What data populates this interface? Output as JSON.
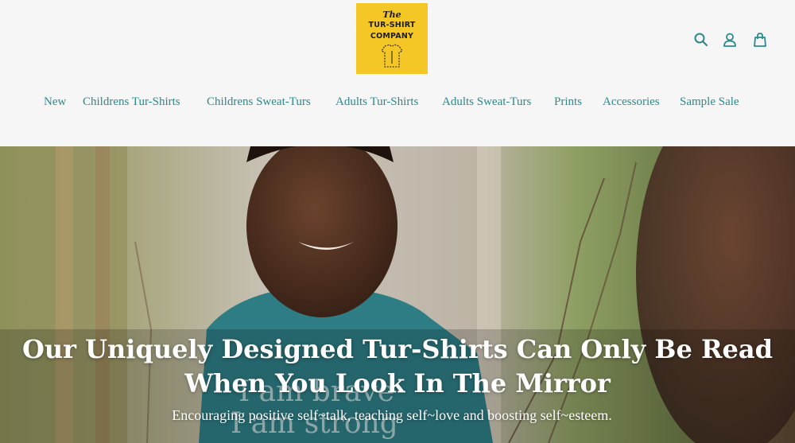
{
  "brand": {
    "logo_the": "The",
    "logo_line1": "TUR-SHIRT",
    "logo_line2": "COMPANY",
    "logo_color": "#f4c726"
  },
  "header_icons": [
    {
      "name": "search-icon"
    },
    {
      "name": "account-icon"
    },
    {
      "name": "cart-icon"
    }
  ],
  "nav": {
    "items": [
      {
        "label": "New"
      },
      {
        "label": "Childrens Tur-Shirts"
      },
      {
        "label": "Childrens Sweat-Turs"
      },
      {
        "label": "Adults Tur-Shirts"
      },
      {
        "label": "Adults Sweat-Turs"
      },
      {
        "label": "Prints"
      },
      {
        "label": "Accessories"
      },
      {
        "label": "Sample Sale"
      }
    ],
    "color": "#2a8a8c"
  },
  "hero": {
    "title": "Our Uniquely Designed Tur-Shirts Can Only Be Read When You Look In The Mirror",
    "subtitle": "Encouraging positive self~talk, teaching self~love and boosting self~esteem.",
    "shirt_text_1": "I am brave",
    "shirt_text_2": "I am strong"
  }
}
